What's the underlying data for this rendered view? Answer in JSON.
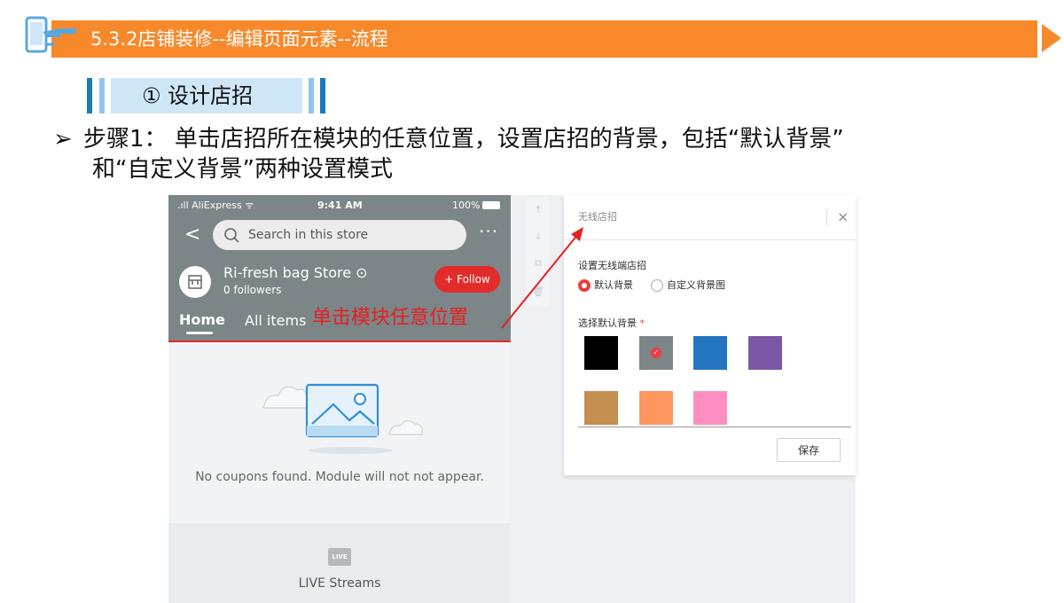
{
  "slide": {
    "header_title": "5.3.2店铺装修--编辑页面元素--流程",
    "step_label": "① 设计店招",
    "bullet": "➢",
    "desc_line1": "步骤1：  单击店招所在模块的任意位置，设置店招的背景，包括“默认背景”",
    "desc_line2": "和“自定义背景”两种设置模式"
  },
  "phone": {
    "status_left": ".ıll AliExpress ᯤ",
    "status_time": "9:41 AM",
    "status_battery": "100%",
    "back": "<",
    "search_placeholder": "Search in this store",
    "more": "···",
    "store_name": "Ri-fresh bag Store ⊙",
    "followers": "0 followers",
    "follow_button": "+ Follow",
    "tab_home": "Home",
    "tab_all_items": "All items",
    "callout": "单击模块任意位置",
    "empty_message": "No coupons found. Module will not not appear.",
    "live_icon_text": "LIVE",
    "live_label": "LIVE Streams"
  },
  "tools": {
    "up": "↑",
    "down": "↓",
    "copy": "⧉",
    "delete": "🗑"
  },
  "panel": {
    "title": "无线店招",
    "close": "×",
    "setting_label": "设置无线端店招",
    "option_default": "默认背景",
    "option_custom": "自定义背景图",
    "select_label": "选择默认背景",
    "required_mark": "*",
    "save_button": "保存",
    "swatches": [
      "#000000",
      "#7c8588",
      "#2375c1",
      "#7b57a6",
      "#c58f52",
      "#ff9660",
      "#ff8fc2"
    ],
    "selected_swatch": 1
  },
  "colors": {
    "header_orange": "#f7892b",
    "accent_red": "#e22b2b",
    "phone_header_gray": "#7c8588"
  }
}
